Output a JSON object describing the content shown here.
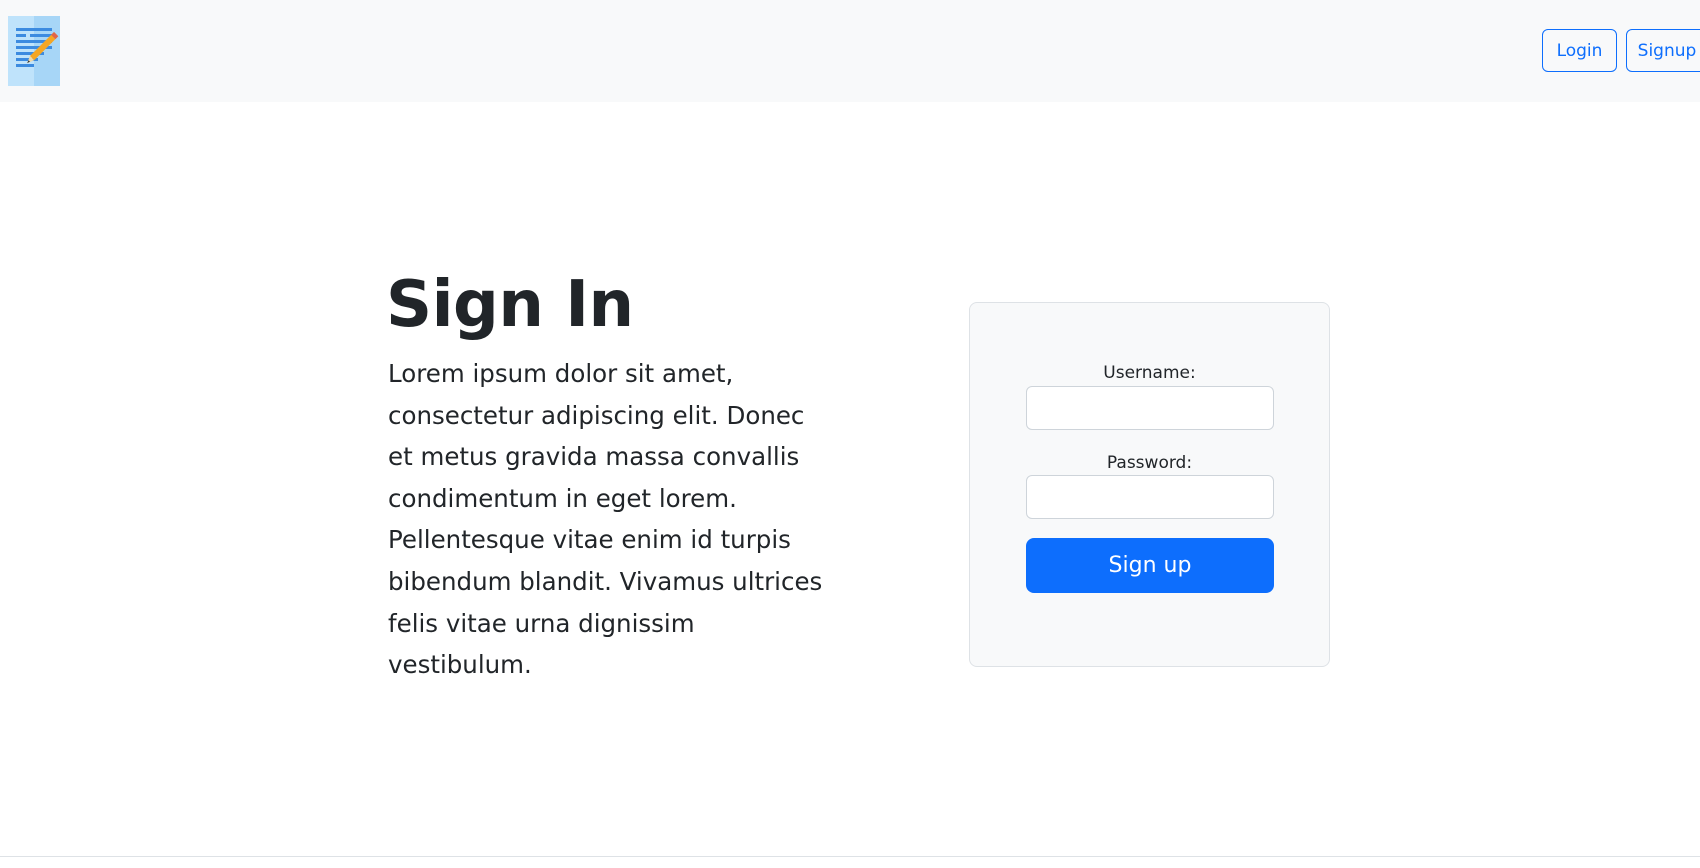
{
  "navbar": {
    "logo_icon": "notepad-pencil-icon",
    "login_label": "Login",
    "signup_label": "Signup"
  },
  "intro": {
    "title": "Sign In",
    "text": "Lorem ipsum dolor sit amet, consectetur adipiscing elit. Donec et metus gravida massa convallis condimentum in eget lorem. Pellentesque vitae enim id turpis bibendum blandit. Vivamus ultrices felis vitae urna dignissim vestibulum."
  },
  "form": {
    "username_label": "Username:",
    "username_value": "",
    "password_label": "Password:",
    "password_value": "",
    "submit_label": "Sign up"
  },
  "colors": {
    "primary": "#0d6efd",
    "navbar_bg": "#f8f9fa",
    "card_bg": "#f8f9fa",
    "text": "#212529"
  }
}
